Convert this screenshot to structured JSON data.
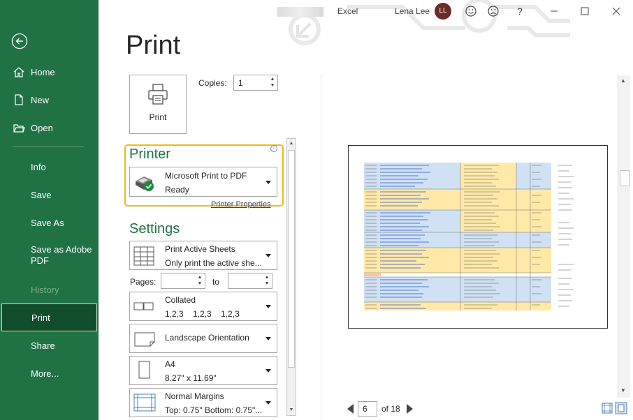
{
  "sidebar": {
    "items": [
      {
        "label": "Home"
      },
      {
        "label": "New"
      },
      {
        "label": "Open"
      },
      {
        "label": "Info"
      },
      {
        "label": "Save"
      },
      {
        "label": "Save As"
      },
      {
        "label": "Save as Adobe PDF"
      },
      {
        "label": "History"
      },
      {
        "label": "Print"
      },
      {
        "label": "Share"
      },
      {
        "label": "More..."
      }
    ],
    "selected": "Print",
    "accent": "#207245"
  },
  "titlebar": {
    "app": "Excel",
    "user": "Lena Lee",
    "initials": "LL",
    "help": "?"
  },
  "print": {
    "title": "Print",
    "button_label": "Print",
    "copies_label": "Copies:",
    "copies_value": "1",
    "printer_heading": "Printer",
    "printer_name": "Microsoft Print to PDF",
    "printer_status": "Ready",
    "printer_properties": "Printer Properties",
    "info_icon": "i",
    "settings_heading": "Settings",
    "settings": [
      {
        "line1": "Print Active Sheets",
        "line2": "Only print the active she..."
      },
      {
        "line1": "Collated",
        "line2": "1,2,3    1,2,3    1,2,3"
      },
      {
        "line1": "Landscape Orientation",
        "line2": ""
      },
      {
        "line1": "A4",
        "line2": "8.27\" x 11.69\""
      },
      {
        "line1": "Normal Margins",
        "line2": "Top: 0.75\" Bottom: 0.75\"..."
      }
    ],
    "pages_label": "Pages:",
    "to_label": "to",
    "highlight_color": "#f0b915"
  },
  "preview": {
    "current_page": "6",
    "of_label": "of 18"
  }
}
